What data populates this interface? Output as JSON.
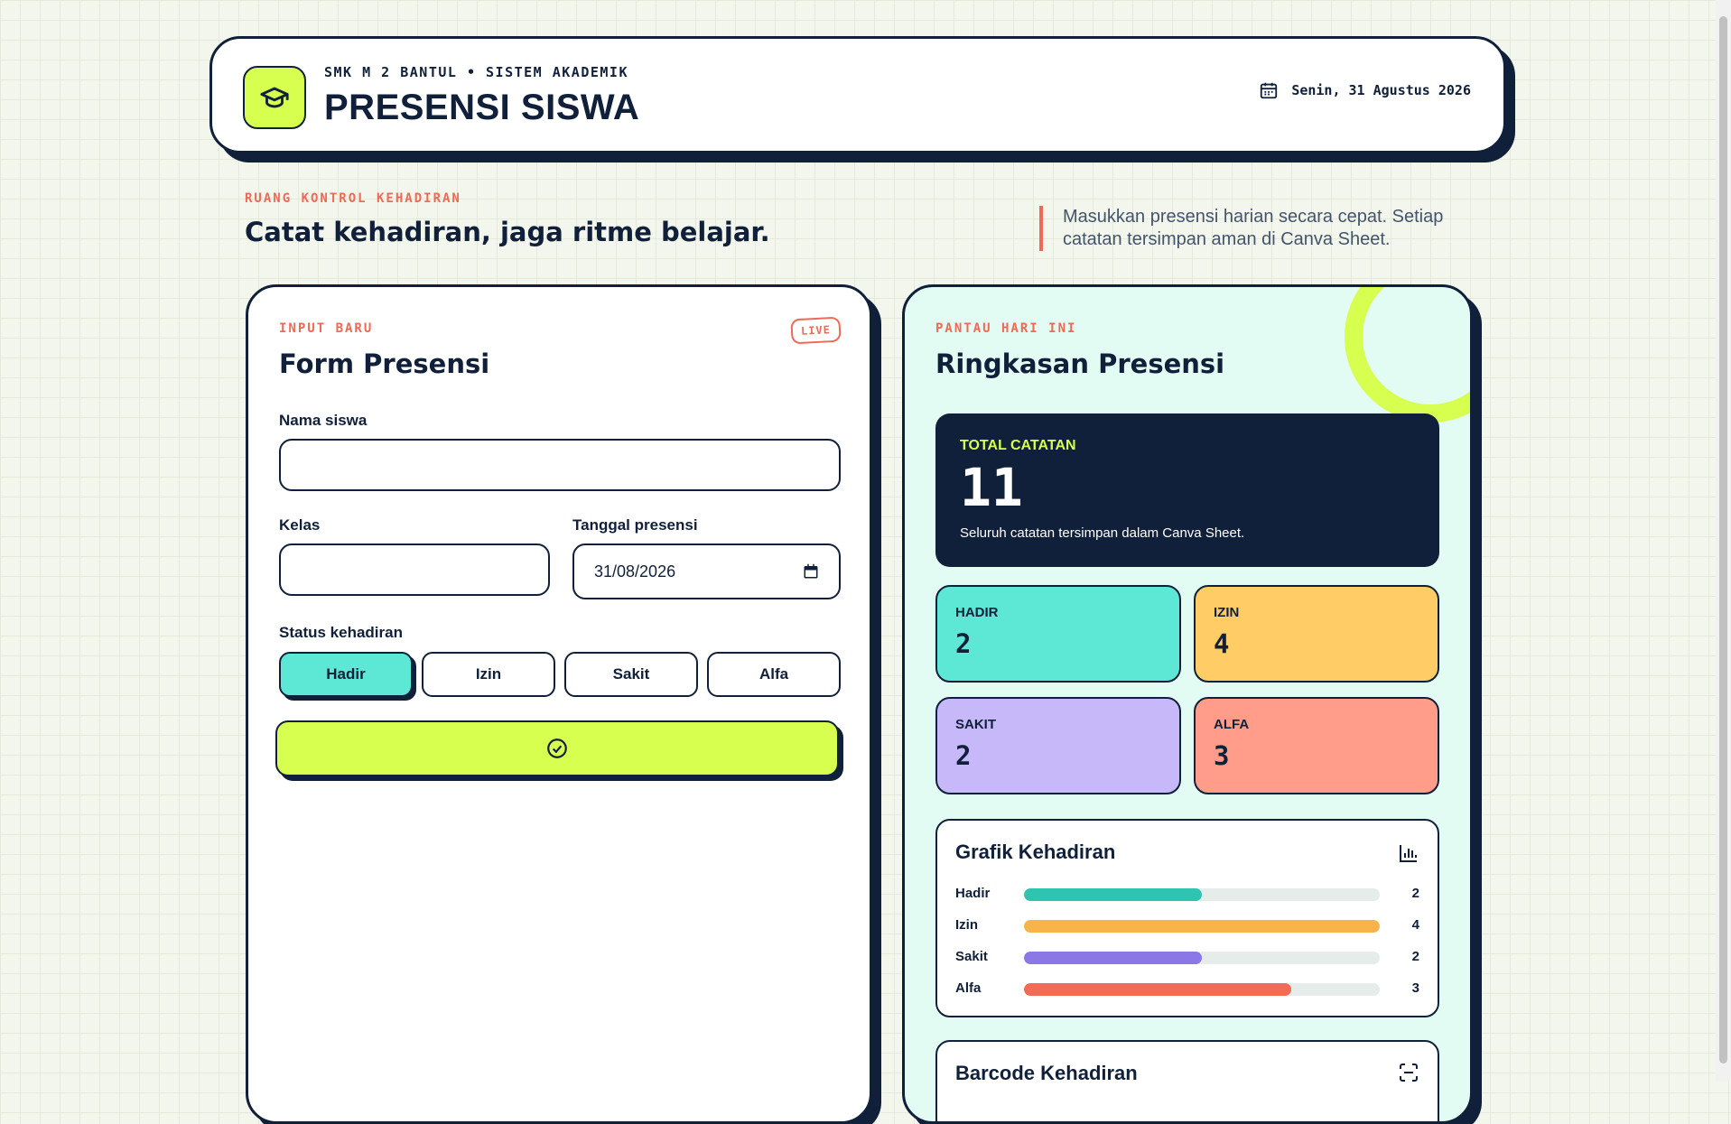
{
  "header": {
    "school": "SMK M 2 BANTUL • SISTEM AKADEMIK",
    "title": "PRESENSI SISWA",
    "date": "Senin, 31 Agustus 2026"
  },
  "intro": {
    "kicker": "RUANG KONTROL KEHADIRAN",
    "title": "Catat kehadiran, jaga ritme belajar.",
    "note": "Masukkan presensi harian secara cepat. Setiap catatan tersimpan aman di Canva Sheet."
  },
  "form": {
    "kicker": "INPUT BARU",
    "badge": "LIVE",
    "title": "Form Presensi",
    "name_label": "Nama siswa",
    "name_value": "",
    "class_label": "Kelas",
    "class_value": "",
    "date_label": "Tanggal presensi",
    "date_value": "31/08/2026",
    "status_label": "Status kehadiran",
    "statuses": [
      "Hadir",
      "Izin",
      "Sakit",
      "Alfa"
    ],
    "selected_status": "Hadir"
  },
  "summary": {
    "kicker": "PANTAU HARI INI",
    "title": "Ringkasan Presensi",
    "total_label": "TOTAL CATATAN",
    "total_value": "11",
    "total_desc": "Seluruh catatan tersimpan dalam Canva Sheet.",
    "stats": [
      {
        "label": "HADIR",
        "value": "2",
        "color": "#5de8d5"
      },
      {
        "label": "IZIN",
        "value": "4",
        "color": "#ffcc66"
      },
      {
        "label": "SAKIT",
        "value": "2",
        "color": "#c7b8fa"
      },
      {
        "label": "ALFA",
        "value": "3",
        "color": "#ff9d8a"
      }
    ],
    "graph_title": "Grafik Kehadiran",
    "barcode_title": "Barcode Kehadiran"
  },
  "chart_data": {
    "type": "bar",
    "categories": [
      "Hadir",
      "Izin",
      "Sakit",
      "Alfa"
    ],
    "values": [
      2,
      4,
      2,
      3
    ],
    "colors": [
      "#2ec4b0",
      "#f8b44a",
      "#8b78e6",
      "#f26b55"
    ],
    "xlim": [
      0,
      4
    ]
  },
  "colors": {
    "navy": "#10203a",
    "lime": "#d6ff4f",
    "coral": "#ef6a55",
    "mint_bg": "#e2fbf3"
  },
  "icons": [
    "graduation-cap-icon",
    "calendar-icon",
    "check-circle-icon",
    "bar-chart-icon",
    "scan-icon"
  ]
}
